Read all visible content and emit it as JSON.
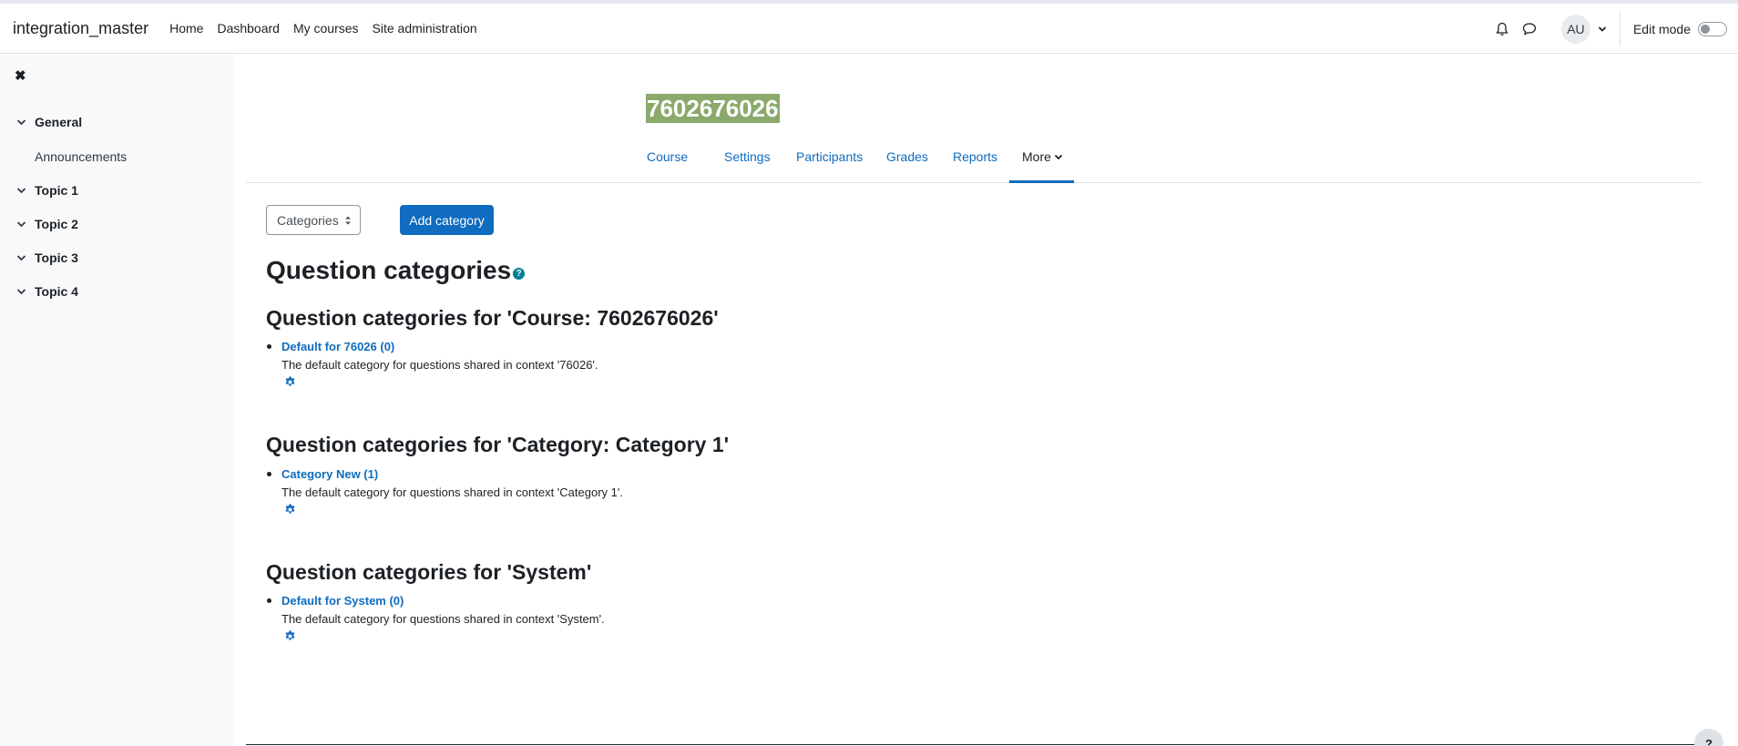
{
  "header": {
    "brand": "integration_master",
    "nav": [
      "Home",
      "Dashboard",
      "My courses",
      "Site administration"
    ],
    "avatar_initials": "AU",
    "edit_mode_label": "Edit mode"
  },
  "drawer": {
    "sections": [
      "General",
      "Topic 1",
      "Topic 2",
      "Topic 3",
      "Topic 4"
    ],
    "general_items": [
      "Announcements"
    ]
  },
  "course": {
    "title": "7602676026"
  },
  "secondary_nav": {
    "tabs": [
      "Course",
      "Settings",
      "Participants",
      "Grades",
      "Reports",
      "More"
    ],
    "active": "More"
  },
  "toolbar": {
    "select_value": "Categories",
    "add_button": "Add category"
  },
  "page": {
    "heading": "Question categories",
    "help_glyph": "?"
  },
  "contexts": [
    {
      "heading": "Question categories for 'Course: 7602676026'",
      "category_link": "Default for 76026 (0)",
      "description": "The default category for questions shared in context '76026'."
    },
    {
      "heading": "Question categories for 'Category: Category 1'",
      "category_link": "Category New (1)",
      "description": "The default category for questions shared in context 'Category 1'."
    },
    {
      "heading": "Question categories for 'System'",
      "category_link": "Default for System (0)",
      "description": "The default category for questions shared in context 'System'."
    }
  ],
  "footer": {
    "help_glyph": "?"
  },
  "colors": {
    "link": "#0f6cbf",
    "title_highlight": "#8ba96b",
    "help_icon": "#008196"
  }
}
